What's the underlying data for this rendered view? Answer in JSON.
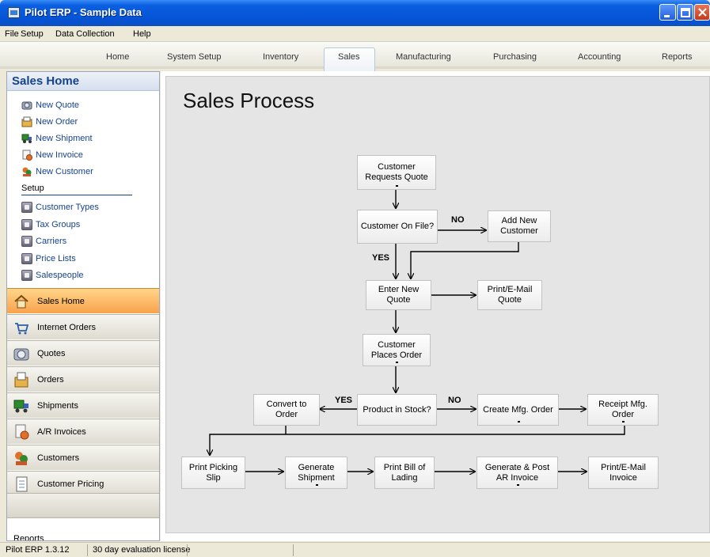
{
  "window": {
    "title": "Pilot ERP - Sample Data"
  },
  "menu": [
    "File",
    "Setup",
    "Data Collection",
    "Help"
  ],
  "tabs": [
    "Home",
    "System Setup",
    "Inventory",
    "Sales",
    "Manufacturing",
    "Purchasing",
    "Accounting",
    "Reports"
  ],
  "active_tab": "Sales",
  "sidebar": {
    "title": "Sales Home",
    "quick_links": [
      "New Quote",
      "New Order",
      "New Shipment",
      "New Invoice",
      "New Customer"
    ],
    "setup_label": "Setup",
    "setup_links": [
      "Customer Types",
      "Tax Groups",
      "Carriers",
      "Price Lists",
      "Salespeople"
    ],
    "nav": [
      "Sales Home",
      "Internet Orders",
      "Quotes",
      "Orders",
      "Shipments",
      "A/R Invoices",
      "Customers",
      "Customer Pricing"
    ],
    "reports_label": "Reports"
  },
  "main": {
    "title": "Sales Process",
    "boxes": {
      "customer_requests_quote": "Customer Requests Quote",
      "customer_on_file": "Customer On File?",
      "add_new_customer": "Add New Customer",
      "enter_new_quote": "Enter New Quote",
      "print_email_quote": "Print/E-Mail Quote",
      "customer_places_order": "Customer Places Order",
      "convert_to_order": "Convert to Order",
      "product_in_stock": "Product in Stock?",
      "create_mfg_order": "Create Mfg. Order",
      "receipt_mfg_order": "Receipt Mfg. Order",
      "print_picking_slip": "Print Picking Slip",
      "generate_shipment": "Generate Shipment",
      "print_bill_of_lading": "Print Bill of Lading",
      "generate_post_ar_invoice": "Generate & Post AR Invoice",
      "print_email_invoice": "Print/E-Mail Invoice"
    },
    "labels": {
      "no_1": "NO",
      "yes_1": "YES",
      "yes_2": "YES",
      "no_2": "NO"
    }
  },
  "status": {
    "version": "Pilot ERP 1.3.12",
    "license": "30 day evaluation license"
  },
  "colors": {
    "titlebar": "#0554d6",
    "active_nav": "#f9a24c",
    "link": "#15428b",
    "flow_bg": "#e5e5e5"
  }
}
